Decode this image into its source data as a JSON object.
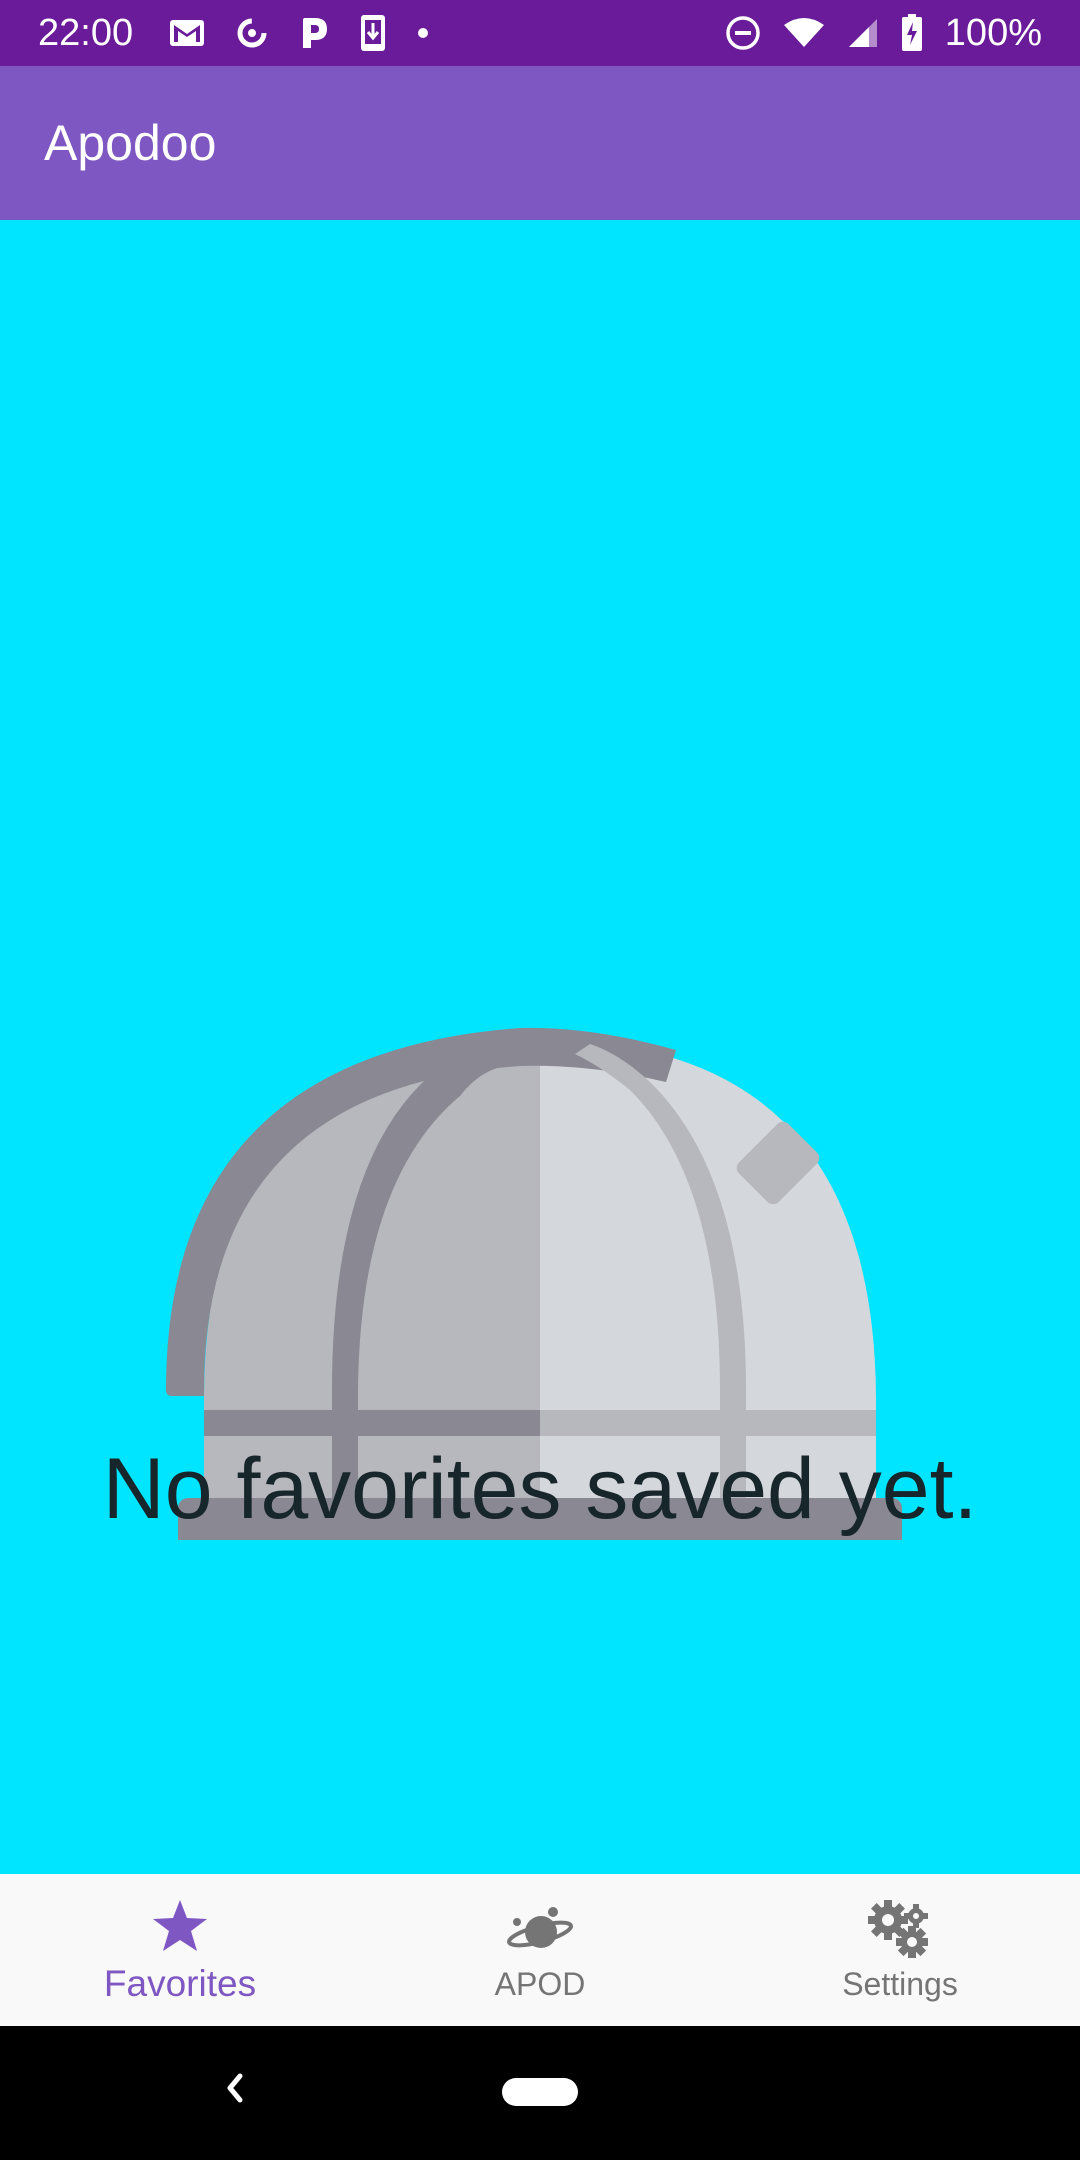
{
  "status_bar": {
    "time": "22:00",
    "battery": "100%",
    "left_icons": [
      "gmail-icon",
      "sync-icon",
      "p-app-icon",
      "download-icon",
      "dot-icon"
    ],
    "right_icons": [
      "dnd-icon",
      "wifi-icon",
      "signal-icon",
      "battery-charging-icon"
    ]
  },
  "app_bar": {
    "title": "Apodoo"
  },
  "content": {
    "empty_message": "No favorites saved yet.",
    "illustration": "observatory-icon",
    "background": "#00e5ff"
  },
  "bottom_nav": {
    "items": [
      {
        "label": "Favorites",
        "icon": "star-icon",
        "active": true
      },
      {
        "label": "APOD",
        "icon": "planet-icon",
        "active": false
      },
      {
        "label": "Settings",
        "icon": "gears-icon",
        "active": false
      }
    ]
  },
  "colors": {
    "status_bar": "#6a1b9a",
    "app_bar": "#7e57c2",
    "accent": "#7e57c2",
    "inactive": "#757575"
  }
}
